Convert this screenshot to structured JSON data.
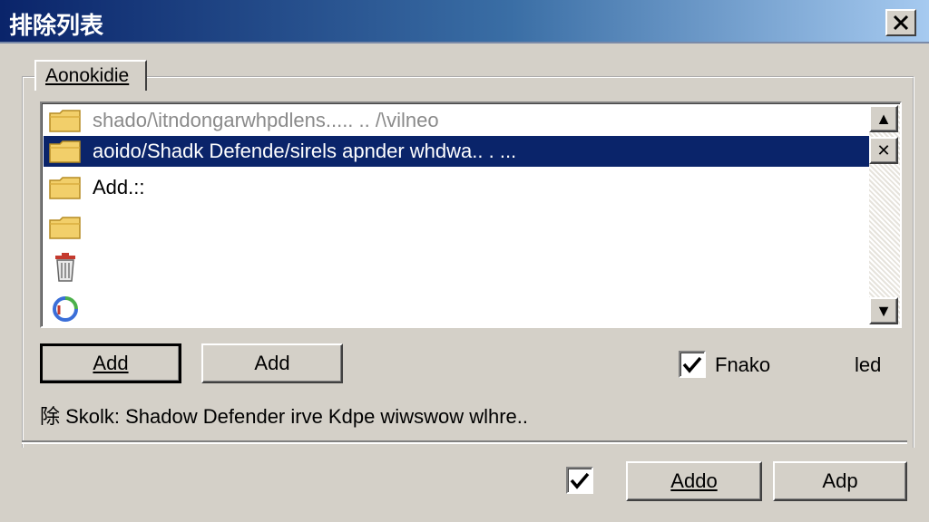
{
  "window": {
    "title": "排除列表",
    "close_glyph": "✕"
  },
  "tab": {
    "label": "Aonokidie"
  },
  "list": {
    "items": [
      {
        "icon": "folder-icon",
        "text": "shado/\\itndongarwhpdlens..... .. /\\vilneo",
        "state": "greyed"
      },
      {
        "icon": "folder-icon",
        "text": "aoido/Shadk Defende/sirels apnder whdwa..  . ...",
        "state": "selected"
      },
      {
        "icon": "folder-icon",
        "text": "Add.::",
        "state": "normal"
      },
      {
        "icon": "folder-icon",
        "text": "",
        "state": "normal"
      },
      {
        "icon": "trash-icon",
        "text": "",
        "state": "normal"
      },
      {
        "icon": "refresh-icon",
        "text": "",
        "state": "normal"
      }
    ]
  },
  "scrollbar": {
    "up_glyph": "▲",
    "down_glyph": "▼",
    "remove_glyph": "✕"
  },
  "buttons": {
    "add_primary": "Add",
    "add_secondary": "Add",
    "ok": "Addo",
    "cancel": "Adp"
  },
  "options": {
    "enable_label": "Fnako",
    "enable_checked": true,
    "enable_suffix": "led",
    "bottom_checked": true
  },
  "status": {
    "text": "除 Skolk:  Shadow Defender irve Kdpe wiwswow wlhre.."
  },
  "colors": {
    "title_start": "#0a246a",
    "title_end": "#a6caf0",
    "selection": "#0a246a",
    "face": "#d4d0c8"
  }
}
